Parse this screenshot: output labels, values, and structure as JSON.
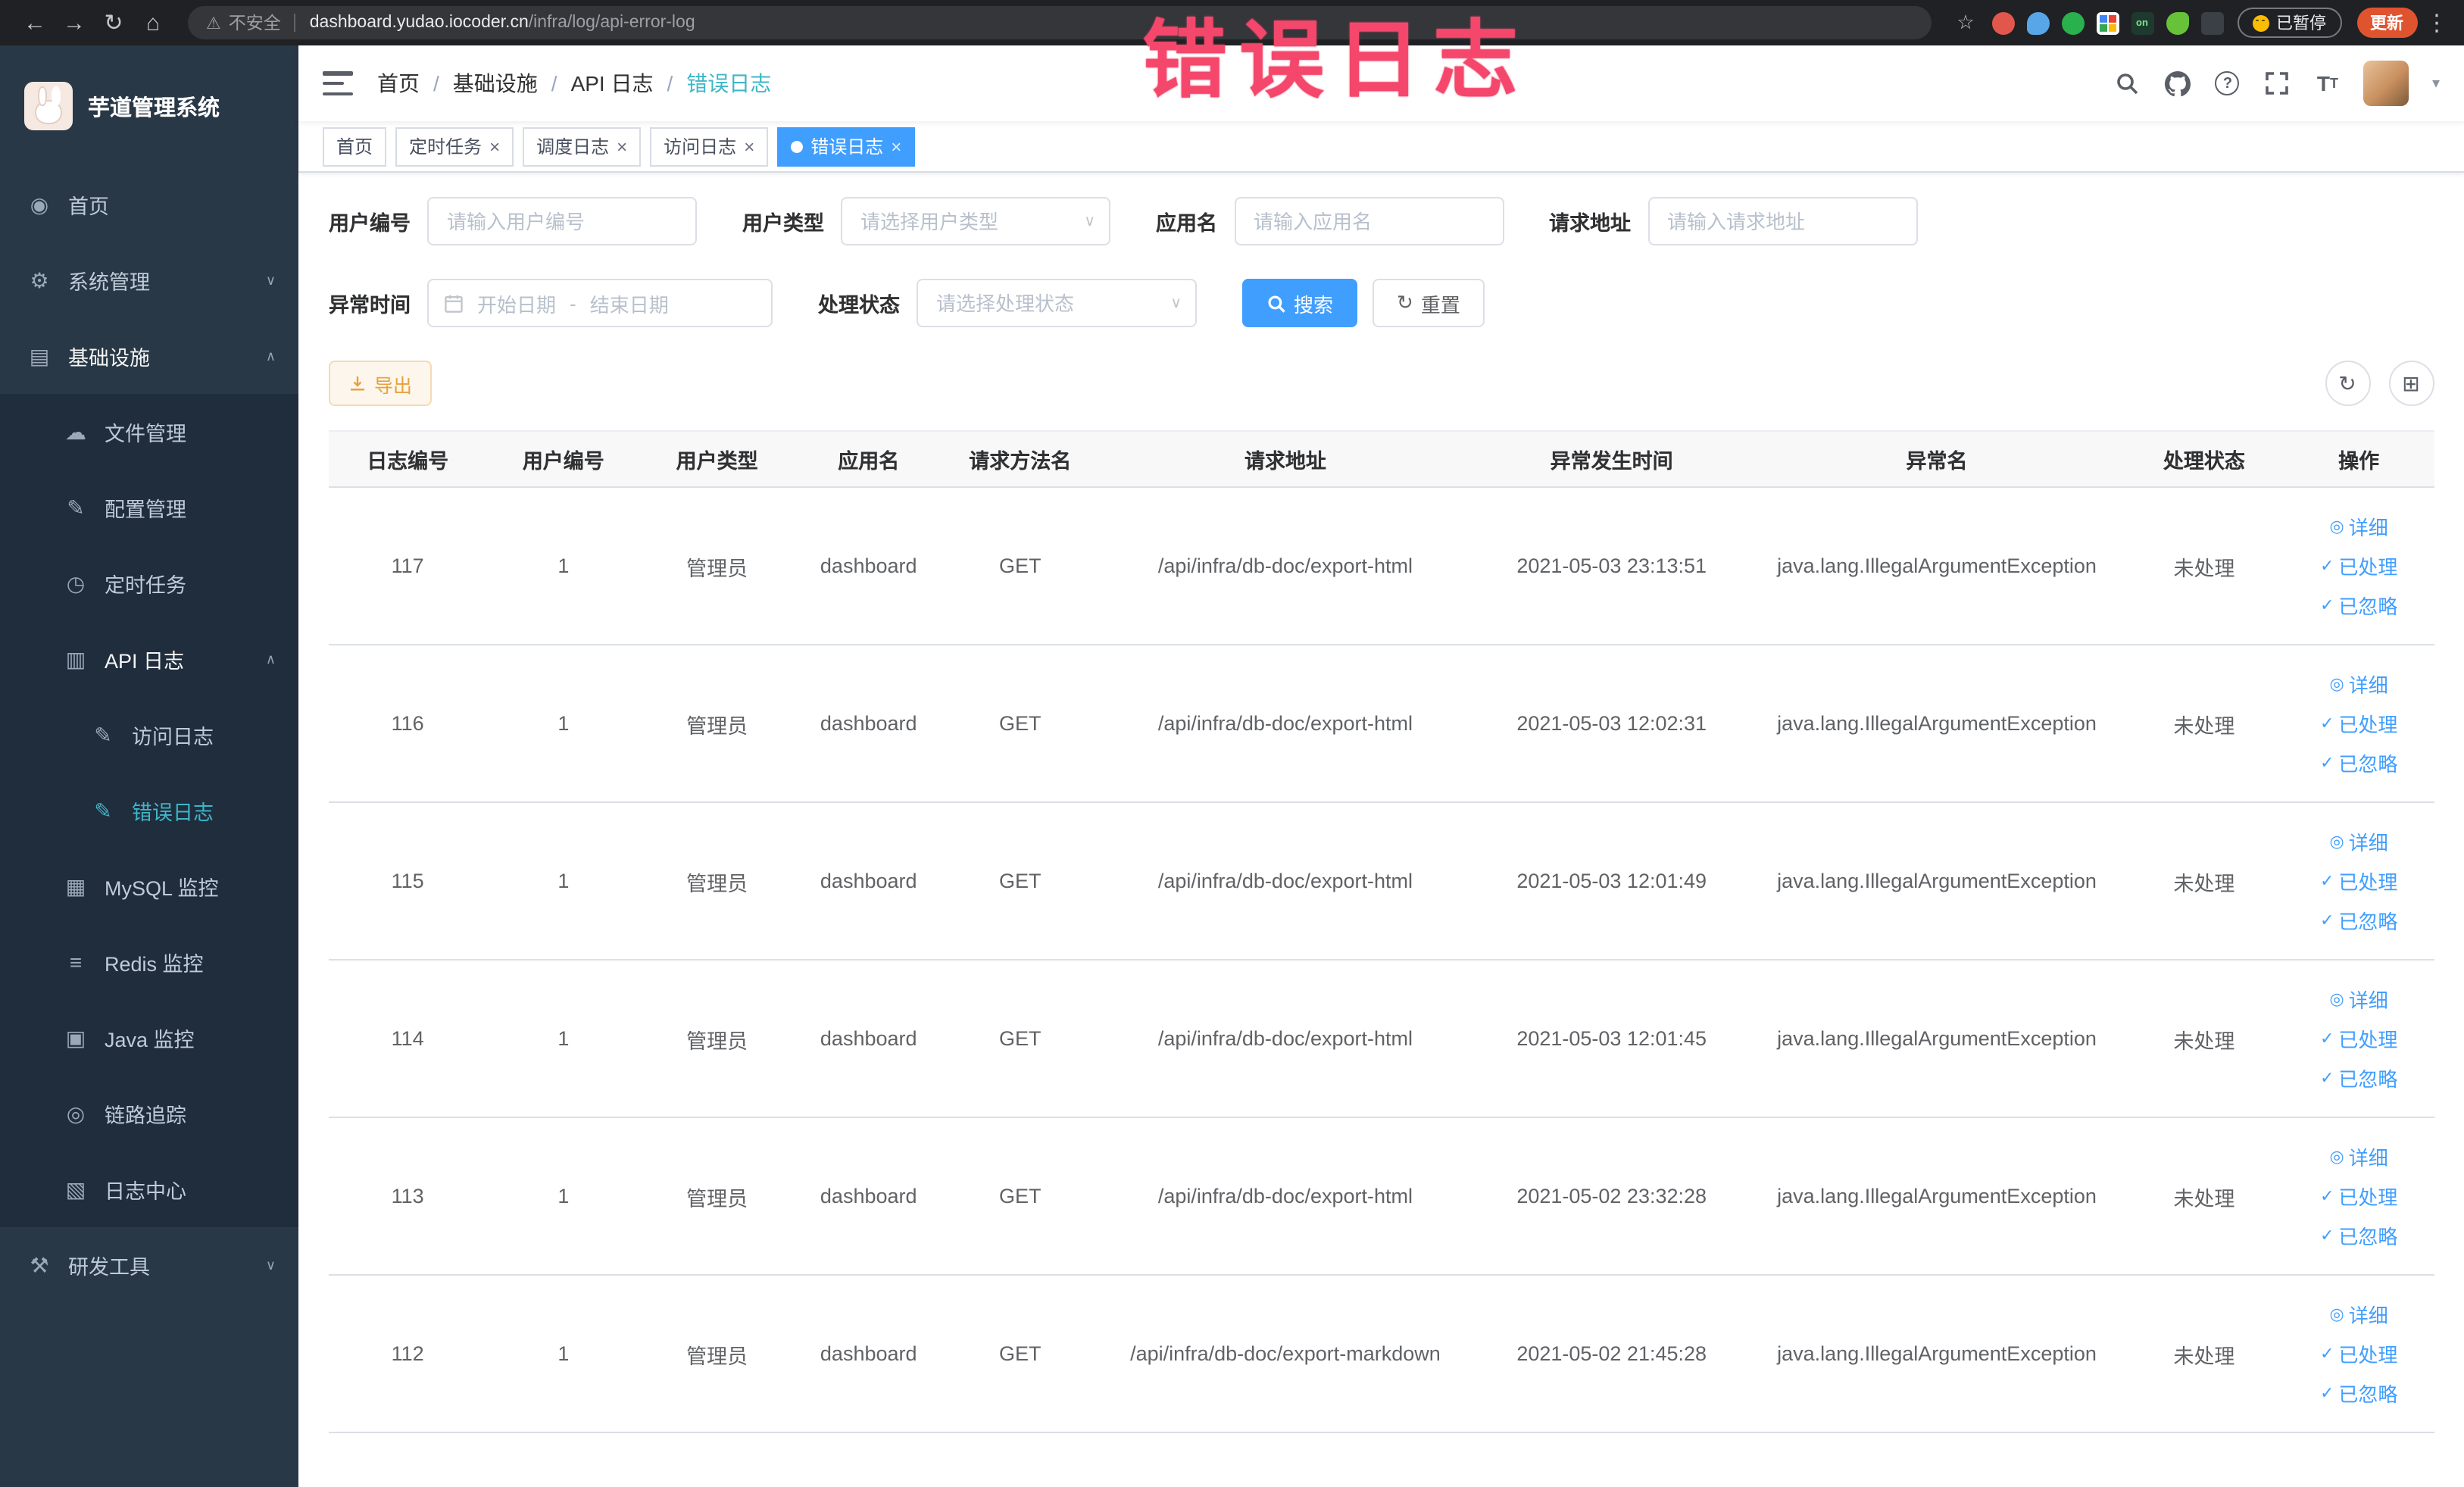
{
  "browser": {
    "security_label": "不安全",
    "url_domain": "dashboard.yudao.iocoder.cn",
    "url_path": "/infra/log/api-error-log",
    "extension_badge": "on",
    "paused_button": "已暂停",
    "update_button": "更新"
  },
  "watermark": "错误日志",
  "colors": {
    "primary_blue": "#409eff",
    "active_teal": "#3eb6c8",
    "warning_orange": "#e6a23c",
    "watermark_pink": "#f4476b",
    "sidebar_bg": "#293846",
    "submenu_bg": "#1f2d3d"
  },
  "sidebar": {
    "logo_title": "芋道管理系统",
    "items": [
      {
        "label": "首页",
        "icon": "dashboard-icon",
        "level": 1
      },
      {
        "label": "系统管理",
        "icon": "gear-icon",
        "level": 1,
        "chevron": "down"
      },
      {
        "label": "基础设施",
        "icon": "infrastructure-icon",
        "level": 1,
        "chevron": "up",
        "expanded": true
      },
      {
        "label": "文件管理",
        "icon": "file-icon",
        "level": 2
      },
      {
        "label": "配置管理",
        "icon": "config-icon",
        "level": 2
      },
      {
        "label": "定时任务",
        "icon": "timer-icon",
        "level": 2
      },
      {
        "label": "API 日志",
        "icon": "api-log-icon",
        "level": 2,
        "chevron": "up",
        "expanded": true
      },
      {
        "label": "访问日志",
        "icon": "access-log-icon",
        "level": 3
      },
      {
        "label": "错误日志",
        "icon": "error-log-icon",
        "level": 3,
        "active": true
      },
      {
        "label": "MySQL 监控",
        "icon": "mysql-icon",
        "level": 2
      },
      {
        "label": "Redis 监控",
        "icon": "redis-icon",
        "level": 2
      },
      {
        "label": "Java 监控",
        "icon": "java-icon",
        "level": 2
      },
      {
        "label": "链路追踪",
        "icon": "trace-icon",
        "level": 2
      },
      {
        "label": "日志中心",
        "icon": "log-center-icon",
        "level": 2
      },
      {
        "label": "研发工具",
        "icon": "tools-icon",
        "level": 1,
        "chevron": "down"
      }
    ]
  },
  "navbar": {
    "breadcrumb_separator": "/",
    "breadcrumb": [
      {
        "label": "首页"
      },
      {
        "label": "基础设施"
      },
      {
        "label": "API 日志"
      },
      {
        "label": "错误日志",
        "current": true
      }
    ]
  },
  "tabs": [
    {
      "label": "首页",
      "closable": false,
      "active": false
    },
    {
      "label": "定时任务",
      "closable": true,
      "active": false
    },
    {
      "label": "调度日志",
      "closable": true,
      "active": false
    },
    {
      "label": "访问日志",
      "closable": true,
      "active": false
    },
    {
      "label": "错误日志",
      "closable": true,
      "active": true
    }
  ],
  "filters": {
    "user_id_label": "用户编号",
    "user_id_placeholder": "请输入用户编号",
    "user_type_label": "用户类型",
    "user_type_placeholder": "请选择用户类型",
    "app_name_label": "应用名",
    "app_name_placeholder": "请输入应用名",
    "request_url_label": "请求地址",
    "request_url_placeholder": "请输入请求地址",
    "exception_time_label": "异常时间",
    "date_start_placeholder": "开始日期",
    "date_separator": "-",
    "date_end_placeholder": "结束日期",
    "process_status_label": "处理状态",
    "process_status_placeholder": "请选择处理状态",
    "search_label": "搜索",
    "reset_label": "重置"
  },
  "toolbar": {
    "export_label": "导出"
  },
  "table": {
    "columns": [
      "日志编号",
      "用户编号",
      "用户类型",
      "应用名",
      "请求方法名",
      "请求地址",
      "异常发生时间",
      "异常名",
      "处理状态",
      "操作"
    ],
    "row_actions": [
      "详细",
      "已处理",
      "已忽略"
    ],
    "rows": [
      {
        "log_id": "117",
        "user_id": "1",
        "user_type": "管理员",
        "app_name": "dashboard",
        "method": "GET",
        "request_url": "/api/infra/db-doc/export-html",
        "time": "2021-05-03 23:13:51",
        "exception_name": "java.lang.IllegalArgumentException",
        "status": "未处理"
      },
      {
        "log_id": "116",
        "user_id": "1",
        "user_type": "管理员",
        "app_name": "dashboard",
        "method": "GET",
        "request_url": "/api/infra/db-doc/export-html",
        "time": "2021-05-03 12:02:31",
        "exception_name": "java.lang.IllegalArgumentException",
        "status": "未处理"
      },
      {
        "log_id": "115",
        "user_id": "1",
        "user_type": "管理员",
        "app_name": "dashboard",
        "method": "GET",
        "request_url": "/api/infra/db-doc/export-html",
        "time": "2021-05-03 12:01:49",
        "exception_name": "java.lang.IllegalArgumentException",
        "status": "未处理"
      },
      {
        "log_id": "114",
        "user_id": "1",
        "user_type": "管理员",
        "app_name": "dashboard",
        "method": "GET",
        "request_url": "/api/infra/db-doc/export-html",
        "time": "2021-05-03 12:01:45",
        "exception_name": "java.lang.IllegalArgumentException",
        "status": "未处理"
      },
      {
        "log_id": "113",
        "user_id": "1",
        "user_type": "管理员",
        "app_name": "dashboard",
        "method": "GET",
        "request_url": "/api/infra/db-doc/export-html",
        "time": "2021-05-02 23:32:28",
        "exception_name": "java.lang.IllegalArgumentException",
        "status": "未处理"
      },
      {
        "log_id": "112",
        "user_id": "1",
        "user_type": "管理员",
        "app_name": "dashboard",
        "method": "GET",
        "request_url": "/api/infra/db-doc/export-markdown",
        "time": "2021-05-02 21:45:28",
        "exception_name": "java.lang.IllegalArgumentException",
        "status": "未处理"
      }
    ]
  }
}
